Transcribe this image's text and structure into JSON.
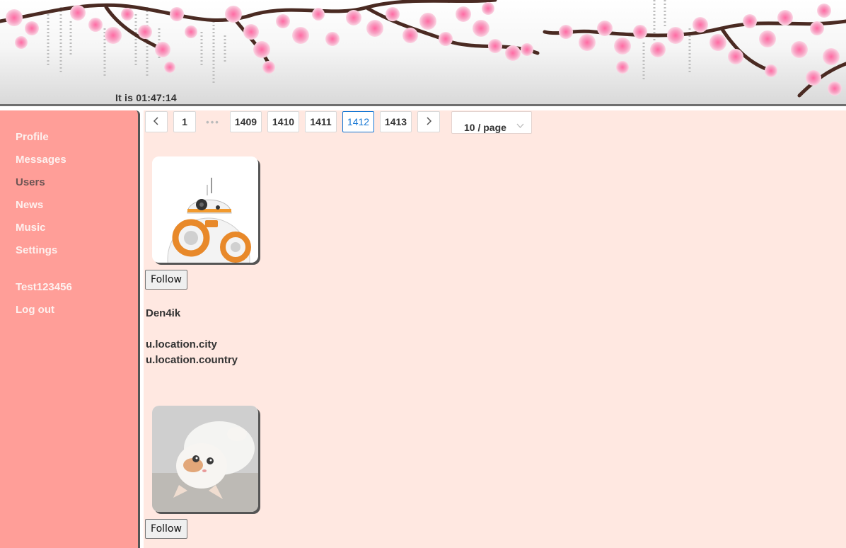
{
  "header": {
    "clock_prefix": "It is",
    "clock_time": "01:47:14"
  },
  "sidebar": {
    "items": [
      {
        "label": "Profile"
      },
      {
        "label": "Messages"
      },
      {
        "label": "Users",
        "active": true
      },
      {
        "label": "News"
      },
      {
        "label": "Music"
      },
      {
        "label": "Settings"
      }
    ],
    "account": {
      "username": "Test123456",
      "logout_label": "Log out"
    }
  },
  "pagination": {
    "prev_icon": "chevron-left-icon",
    "next_icon": "chevron-right-icon",
    "first": "1",
    "ellipsis": "•••",
    "pages": [
      "1409",
      "1410",
      "1411",
      "1412",
      "1413"
    ],
    "current": "1412",
    "page_size": "10 / page"
  },
  "users": [
    {
      "avatar": "bb8-droid-photo",
      "follow_label": "Follow",
      "name": "Den4ik",
      "city": "u.location.city",
      "country": "u.location.country"
    },
    {
      "avatar": "white-kitten-photo",
      "follow_label": "Follow"
    }
  ],
  "colors": {
    "sidebar_bg": "#ff9e98",
    "content_bg": "#ffe8e1",
    "active_page": "#1677d4"
  }
}
